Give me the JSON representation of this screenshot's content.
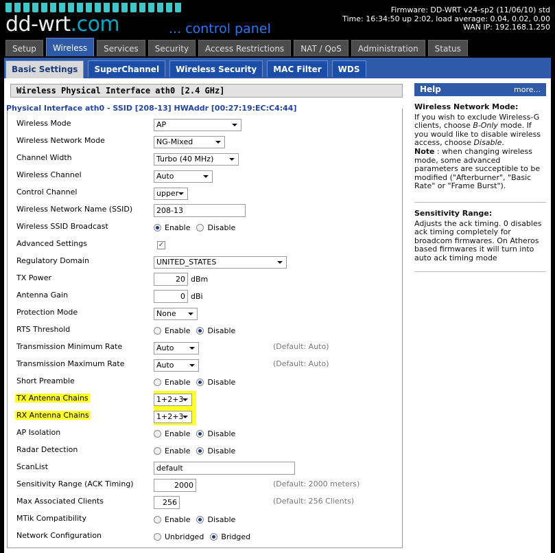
{
  "header": {
    "logo_text": "dd-wrt",
    "logo_suffix": ".com",
    "tagline": "... control panel",
    "firmware": "Firmware: DD-WRT v24-sp2 (11/06/10) std",
    "time": "Time: 16:34:50 up 2:02, load average: 0.04, 0.02, 0.00",
    "wan_ip": "WAN IP: 192.168.1.250"
  },
  "main_tabs": [
    {
      "label": "Setup",
      "active": false
    },
    {
      "label": "Wireless",
      "active": true
    },
    {
      "label": "Services",
      "active": false
    },
    {
      "label": "Security",
      "active": false
    },
    {
      "label": "Access Restrictions",
      "active": false
    },
    {
      "label": "NAT / QoS",
      "active": false
    },
    {
      "label": "Administration",
      "active": false
    },
    {
      "label": "Status",
      "active": false
    }
  ],
  "sub_tabs": [
    {
      "label": "Basic Settings",
      "active": true
    },
    {
      "label": "SuperChannel",
      "active": false
    },
    {
      "label": "Wireless Security",
      "active": false
    },
    {
      "label": "MAC Filter",
      "active": false
    },
    {
      "label": "WDS",
      "active": false
    }
  ],
  "section_title": "Wireless Physical Interface ath0 [2.4 GHz]",
  "interface_legend": "Physical Interface ath0 - SSID [208-13] HWAddr [00:27:19:EC:C4:44]",
  "settings": [
    {
      "label": "Wireless Mode",
      "type": "select",
      "value": "AP"
    },
    {
      "label": "Wireless Network Mode",
      "type": "select",
      "value": "NG-Mixed"
    },
    {
      "label": "Channel Width",
      "type": "select",
      "value": "Turbo (40 MHz)"
    },
    {
      "label": "Wireless Channel",
      "type": "select",
      "value": "Auto"
    },
    {
      "label": "Control Channel",
      "type": "select",
      "value": "upper"
    },
    {
      "label": "Wireless Network Name (SSID)",
      "type": "text",
      "value": "208-13"
    },
    {
      "label": "Wireless SSID Broadcast",
      "type": "radio",
      "options": [
        "Enable",
        "Disable"
      ],
      "selected": "Enable"
    },
    {
      "label": "Advanced Settings",
      "type": "checkbox",
      "checked": true
    },
    {
      "label": "Regulatory Domain",
      "type": "select",
      "value": "UNITED_STATES"
    },
    {
      "label": "TX Power",
      "type": "number",
      "value": "20",
      "unit": "dBm"
    },
    {
      "label": "Antenna Gain",
      "type": "number",
      "value": "0",
      "unit": "dBi"
    },
    {
      "label": "Protection Mode",
      "type": "select",
      "value": "None"
    },
    {
      "label": "RTS Threshold",
      "type": "radio",
      "options": [
        "Enable",
        "Disable"
      ],
      "selected": "Disable"
    },
    {
      "label": "Transmission Minimum Rate",
      "type": "select",
      "value": "Auto",
      "hint": "(Default: Auto)"
    },
    {
      "label": "Transmission Maximum Rate",
      "type": "select",
      "value": "Auto",
      "hint": "(Default: Auto)"
    },
    {
      "label": "Short Preamble",
      "type": "radio",
      "options": [
        "Enable",
        "Disable"
      ],
      "selected": "Disable"
    },
    {
      "label": "TX Antenna Chains",
      "type": "select",
      "value": "1+2+3",
      "highlight": true
    },
    {
      "label": "RX Antenna Chains",
      "type": "select",
      "value": "1+2+3",
      "highlight": true
    },
    {
      "label": "AP Isolation",
      "type": "radio",
      "options": [
        "Enable",
        "Disable"
      ],
      "selected": "Disable"
    },
    {
      "label": "Radar Detection",
      "type": "radio",
      "options": [
        "Enable",
        "Disable"
      ],
      "selected": "Disable"
    },
    {
      "label": "ScanList",
      "type": "text",
      "value": "default"
    },
    {
      "label": "Sensitivity Range (ACK Timing)",
      "type": "number",
      "value": "2000",
      "hint": "(Default: 2000 meters)"
    },
    {
      "label": "Max Associated Clients",
      "type": "number",
      "value": "256",
      "hint": "(Default: 256 Clients)"
    },
    {
      "label": "MTik Compatibility",
      "type": "radio",
      "options": [
        "Enable",
        "Disable"
      ],
      "selected": "Disable"
    },
    {
      "label": "Network Configuration",
      "type": "radio",
      "options": [
        "Unbridged",
        "Bridged"
      ],
      "selected": "Bridged"
    }
  ],
  "help": {
    "title": "Help",
    "more": "more...",
    "sections": [
      {
        "heading": "Wireless Network Mode:",
        "body_1": "If you wish to exclude Wireless-G clients, choose ",
        "em_1": "B-Only",
        "body_2": " mode. If you would like to disable wireless access, choose ",
        "em_2": "Disable",
        "body_3": ".",
        "note_label": "Note",
        "note": " : when changing wireless mode, some advanced parameters are succeptible to be modified (\"Afterburner\", \"Basic Rate\" or \"Frame Burst\")."
      },
      {
        "heading": "Sensitivity Range:",
        "body": "Adjusts the ack timing. 0 disables ack timing completely for broadcom firmwares. On Atheros based firmwares it will turn into auto ack timing mode"
      }
    ]
  },
  "colors": {
    "tab_active": "#2f5aa8",
    "highlight": "#ffff26",
    "legend": "#2244a8"
  }
}
